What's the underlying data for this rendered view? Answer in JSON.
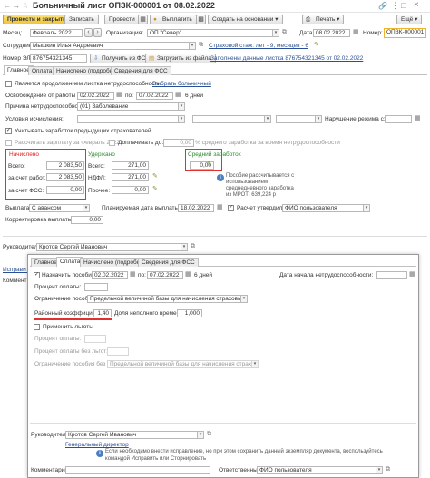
{
  "title": "Больничный лист ОПЗК-000001 от 08.02.2022",
  "toolbar": {
    "post_close": "Провести и закрыть",
    "save": "Записать",
    "post": "Провести",
    "pay": "Выплатить",
    "create_based": "Создать на основании",
    "print": "Печать",
    "more": "Ещё"
  },
  "header": {
    "month_label": "Месяц:",
    "month_value": "Февраль 2022",
    "org_label": "Организация:",
    "org_value": "ОП \"Север\"",
    "date_label": "Дата:",
    "date_value": "08.02.2022",
    "num_label": "Номер:",
    "num_value": "ОПЗК-000001",
    "employee_label": "Сотрудник:",
    "employee_value": "Мышкин Илья Андреевич",
    "insurance_link": "Страховой стаж: лет - 9, месяцев - 6",
    "eln_label": "Номер ЭЛН:",
    "eln_value": "876754321345",
    "get_fss_btn": "Получить из ФСС",
    "load_file_btn": "Загрузить из файла",
    "eln_link": "Заполнены данные листка 876754321345 от 02.02.2022"
  },
  "tabs1": [
    "Главное",
    "Оплата",
    "Начислено (подробно)",
    "Сведения для ФСС"
  ],
  "main": {
    "continuation_label": "Является продолжением листка нетрудоспособности",
    "choose_link": "Выбрать больничный",
    "release_label": "Освобождение от работы с:",
    "from_date": "02.02.2022",
    "to_label": "по:",
    "to_date": "07.02.2022",
    "days": "6 дней",
    "reason_label": "Причина нетрудоспособности:",
    "reason_value": "(01) Заболевание",
    "conditions_label": "Условия исчисления:",
    "violation_label": "Нарушение режима с:",
    "earnings_check": "Учитывать заработок предыдущих страхователей",
    "calc_earnings_label": "Рассчитать зарплату за Февраль 2022",
    "add_to_label": "Доплачивать до:",
    "add_value": "0,00",
    "avg_percent_label": "% среднего заработка за время нетрудоспособности"
  },
  "totals": {
    "accrued_header": "Начислено",
    "withheld_header": "Удержано",
    "avg_header": "Средний заработок",
    "total_label": "Всего:",
    "total_value": "2 083,50",
    "employer_label": "за счет работ.:",
    "employer_value": "2 083,50",
    "fss_label": "за счет ФСС:",
    "fss_value": "0,00",
    "withheld_total_label": "Всего:",
    "withheld_total_value": "271,00",
    "ndfl_label": "НДФЛ:",
    "ndfl_value": "271,00",
    "other_label": "Прочее:",
    "other_value": "0,00",
    "avg_value": "0,00",
    "avg_note": "Пособие рассчитывается с использованием среднедневного заработка из МРОТ: 639,224 р"
  },
  "payment": {
    "payout_label": "Выплата:",
    "payout_value": "С авансом",
    "planned_label": "Планируемая дата выплаты:",
    "planned_value": "18.02.2022",
    "approve_label": "Расчет утвердил:",
    "approve_value": "ФИО пользователя",
    "correction_label": "Корректировка выплаты:",
    "correction_value": "0,00"
  },
  "back": {
    "manager_label": "Руководитель:",
    "manager_value": "Кротов Сергей Иванович",
    "fix_link": "Исправить",
    "comment_label": "Коммент"
  },
  "tabs2": [
    "Главное",
    "Оплата",
    "Начислено (подробно)",
    "Сведения для ФСС"
  ],
  "pay_tab": {
    "assign_label": "Назначить пособие с:",
    "assign_from": "02.02.2022",
    "to_label": "по:",
    "assign_to": "07.02.2022",
    "days": "6 дней",
    "start_label": "Дата начала нетрудоспособности:",
    "start_value": "",
    "percent_label": "Процент оплаты:",
    "percent_value": "",
    "limit_label": "Ограничение пособия:",
    "limit_value": "Предельной величиной базы для начисления страховых взносов",
    "regional_label": "Районный коэффициент:",
    "regional_value": "1,40",
    "part_time_label": "Доля неполного времени:",
    "part_time_value": "1,000",
    "benefits_label": "Применить льготы",
    "percent2_label": "Процент оплаты:",
    "percent_base_label": "Процент оплаты без льгот:",
    "limit_base_label": "Ограничение пособия без льгот:",
    "limit_base_value": "Предельной величиной базы для начисления страховых взносов"
  },
  "footer": {
    "manager_label": "Руководитель:",
    "manager_value": "Кротов Сергей Иванович",
    "position_link": "Генеральный директор",
    "info": "Если необходимо внести исправление, но при этом сохранить данный экземпляр документа, воспользуйтесь командой Исправить или Сторнировать",
    "comment_label": "Комментарий:",
    "comment_value": "",
    "resp_label": "Ответственный:",
    "resp_value": "ФИО пользователя"
  },
  "colors": {
    "accent_red": "#e03131",
    "primary_btn": "#f2c437",
    "link": "#2a4f96",
    "green_header": "#2f8a2f"
  }
}
